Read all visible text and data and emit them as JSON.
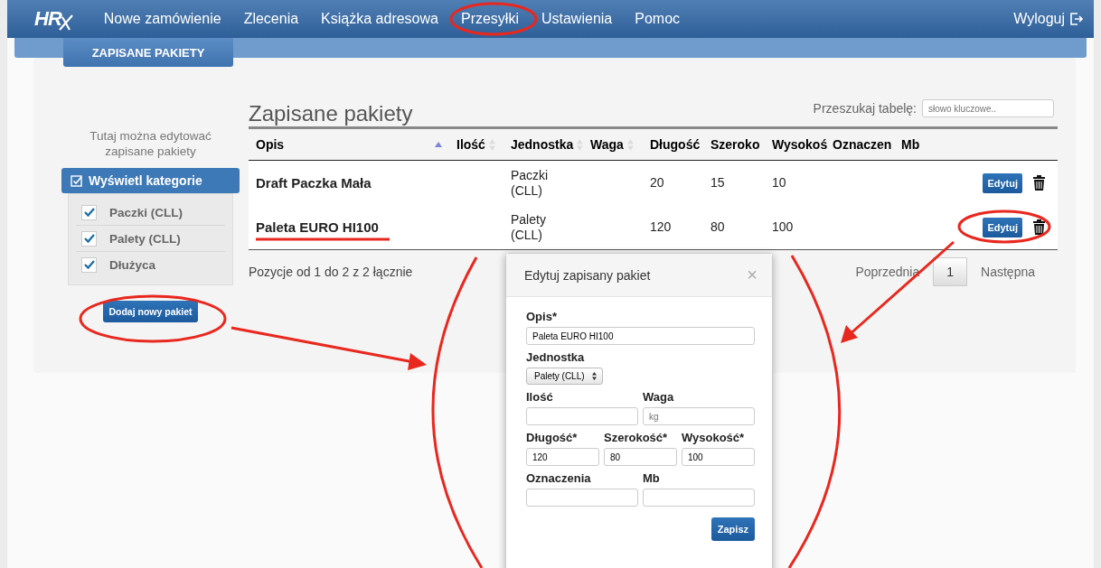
{
  "nav": {
    "logo": "HR",
    "items": [
      {
        "label": "Nowe zamówienie"
      },
      {
        "label": "Zlecenia"
      },
      {
        "label": "Książka adresowa"
      },
      {
        "label": "Przesyłki"
      },
      {
        "label": "Ustawienia"
      },
      {
        "label": "Pomoc"
      }
    ],
    "logout": "Wyloguj"
  },
  "subtab": {
    "label": "ZAPISANE PAKIETY"
  },
  "sidebar": {
    "hint": "Tutaj można edytować zapisane pakiety",
    "panel_title": "Wyświetl kategorie",
    "categories": [
      {
        "label": "Paczki (CLL)",
        "checked": true
      },
      {
        "label": "Palety (CLL)",
        "checked": true
      },
      {
        "label": "Dłużyca",
        "checked": true
      }
    ],
    "add_button": "Dodaj nowy pakiet"
  },
  "main": {
    "title": "Zapisane pakiety",
    "search": {
      "label": "Przeszukaj tabelę:",
      "placeholder": "słowo kluczowe.."
    },
    "table": {
      "columns": [
        {
          "label": "Opis",
          "sortable": true,
          "sorted": true
        },
        {
          "label": "Ilość",
          "sortable": true,
          "sorted": false
        },
        {
          "label": "Jednostka",
          "sortable": true,
          "sorted": false
        },
        {
          "label": "Waga",
          "sortable": true,
          "sorted": false
        },
        {
          "label": "Długość"
        },
        {
          "label": "Szeroko"
        },
        {
          "label": "Wysokoś"
        },
        {
          "label": "Oznaczen"
        },
        {
          "label": "Mb"
        }
      ],
      "rows": [
        {
          "cells": [
            "Draft Paczka Mała",
            "",
            "Paczki (CLL)",
            "",
            "20",
            "15",
            "10",
            "",
            ""
          ],
          "action": "Edytuj"
        },
        {
          "cells": [
            "Paleta EURO HI100",
            "",
            "Palety (CLL)",
            "",
            "120",
            "80",
            "100",
            "",
            ""
          ],
          "action": "Edytuj"
        }
      ]
    },
    "info": "Pozycje od 1 do 2 z 2 łącznie",
    "pagination": [
      {
        "label": "Poprzednia",
        "selected": false
      },
      {
        "label": "1",
        "selected": true
      },
      {
        "label": "Następna",
        "selected": false
      }
    ]
  },
  "modal": {
    "title": "Edytuj zapisany pakiet",
    "close": "×",
    "rows": [
      [
        {
          "label": "Opis*",
          "kind": "text",
          "value": "Paleta EURO HI100"
        }
      ],
      [
        {
          "label": "Jednostka",
          "kind": "select",
          "value": "Palety (CLL)"
        }
      ],
      [
        {
          "label": "Ilość",
          "kind": "text"
        },
        {
          "label": "Waga",
          "kind": "text",
          "placeholder": "kg"
        }
      ],
      [
        {
          "label": "Długość*",
          "kind": "text",
          "value": "120"
        },
        {
          "label": "Szerokość*",
          "kind": "text",
          "value": "80"
        },
        {
          "label": "Wysokość*",
          "kind": "text",
          "value": "100"
        }
      ],
      [
        {
          "label": "Oznaczenia",
          "kind": "text"
        },
        {
          "label": "Mb",
          "kind": "text"
        }
      ]
    ],
    "save": "Zapisz"
  }
}
